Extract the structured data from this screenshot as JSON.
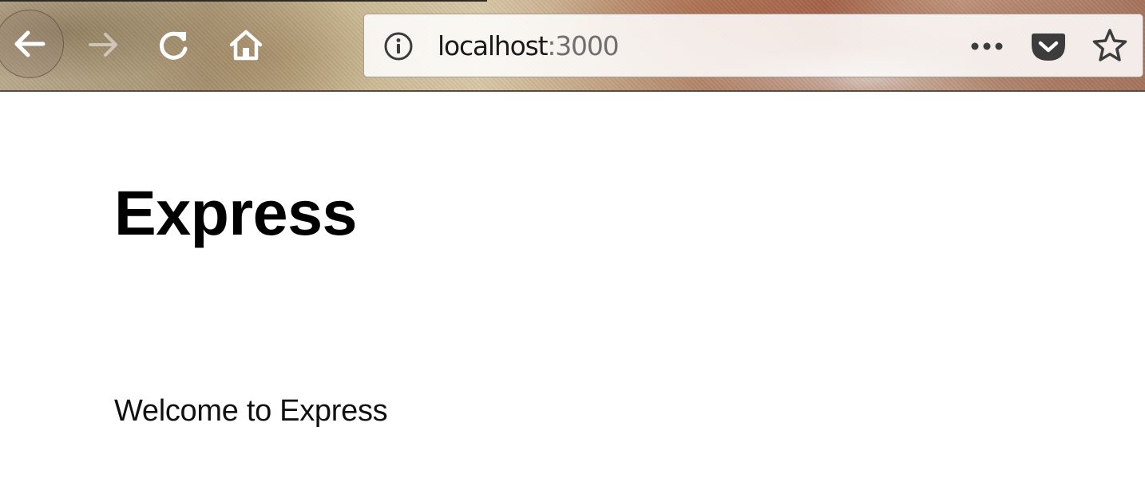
{
  "browser": {
    "url": {
      "host": "localhost",
      "port": ":3000"
    },
    "icons": {
      "back": "arrow-left-icon",
      "forward": "arrow-right-icon",
      "reload": "reload-icon",
      "home": "home-icon",
      "site_info": "info-circle-icon",
      "page_actions": "ellipsis-icon",
      "pocket": "pocket-icon",
      "bookmark": "star-icon"
    },
    "forward_enabled": false
  },
  "page": {
    "heading": "Express",
    "paragraph": "Welcome to Express"
  },
  "colors": {
    "urlbar_background": "#ffffff",
    "url_host": "#1a1a1a",
    "url_port": "#6f6f6f",
    "page_background": "#ffffff",
    "text": "#000000"
  }
}
